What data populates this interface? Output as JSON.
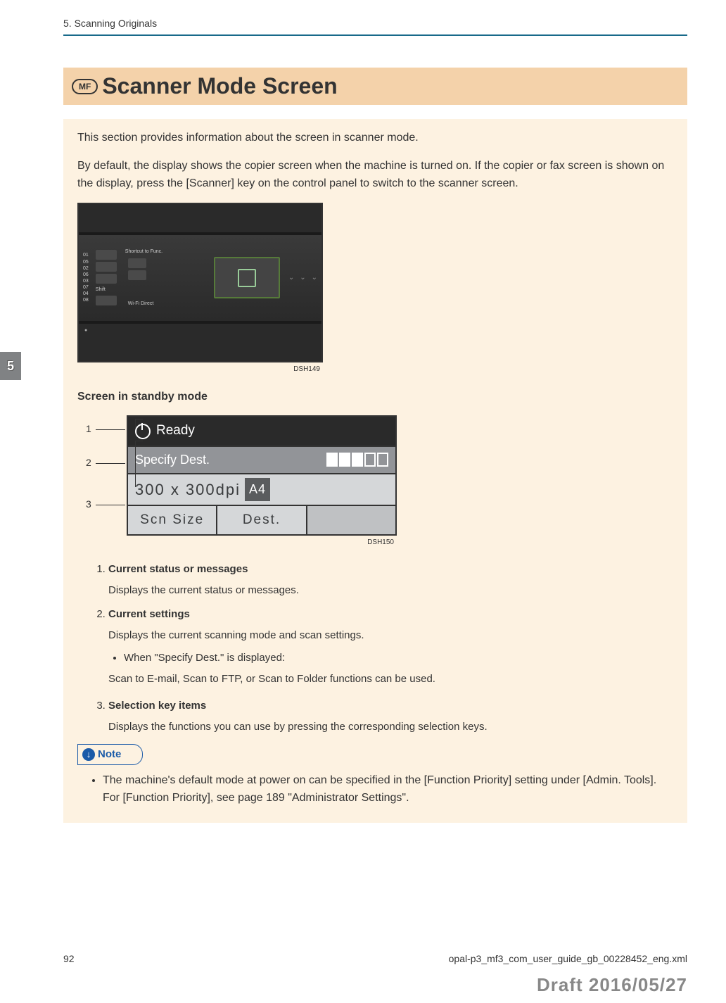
{
  "header": {
    "chapter": "5. Scanning Originals"
  },
  "sideTab": "5",
  "title": {
    "badge": "MF",
    "text": "Scanner Mode Screen"
  },
  "intro": {
    "p1": "This section provides information about the screen in scanner mode.",
    "p2": "By default, the display shows the copier screen when the machine is turned on. If the copier or fax screen is shown on the display, press the [Scanner] key on the control panel to switch to the scanner screen."
  },
  "panelImage": {
    "leftNums": [
      "01",
      "05",
      "02",
      "06",
      "03",
      "07",
      "04",
      "08"
    ],
    "shiftLabel": "Shift",
    "shortcutLabel": "Shortcut to Func.",
    "wifiLabel": "Wi-Fi Direct",
    "caption": "DSH149"
  },
  "standby": {
    "heading": "Screen in standby mode",
    "callouts": [
      "1",
      "2",
      "3"
    ],
    "lcd": {
      "status": "Ready",
      "line2": "Specify Dest.",
      "resolution": "300 x 300dpi",
      "paper": "A4",
      "softkey1": "Scn Size",
      "softkey2": "Dest."
    },
    "caption": "DSH150"
  },
  "list": {
    "items": [
      {
        "title": "Current status or messages",
        "desc": "Displays the current status or messages."
      },
      {
        "title": "Current settings",
        "desc": "Displays the current scanning mode and scan settings.",
        "sub_label": "When \"Specify Dest.\" is displayed:",
        "sub_desc": "Scan to E-mail, Scan to FTP, or Scan to Folder functions can be used."
      },
      {
        "title": "Selection key items",
        "desc": "Displays the functions you can use by pressing the corresponding selection keys."
      }
    ]
  },
  "note": {
    "label": "Note",
    "text": "The machine's default mode at power on can be specified in the [Function Priority] setting under [Admin. Tools]. For [Function Priority], see page 189 \"Administrator Settings\"."
  },
  "footer": {
    "page": "92",
    "file": "opal-p3_mf3_com_user_guide_gb_00228452_eng.xml"
  },
  "draft": "Draft 2016/05/27"
}
